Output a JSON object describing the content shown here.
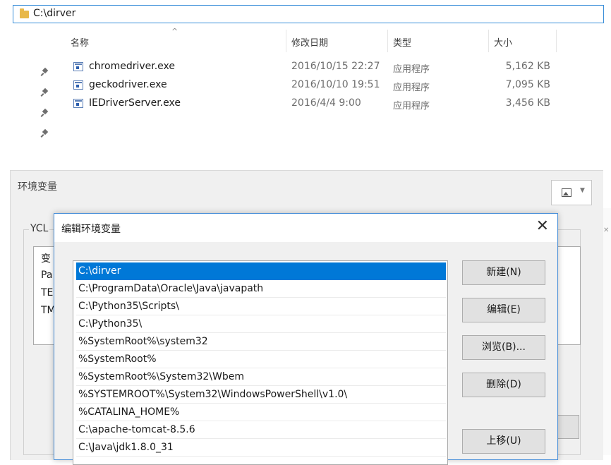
{
  "explorer": {
    "address": "C:\\dirver",
    "columns": {
      "name": "名称",
      "date": "修改日期",
      "type": "类型",
      "size": "大小"
    },
    "files": [
      {
        "name": "chromedriver.exe",
        "date": "2016/10/15 22:27",
        "type": "应用程序",
        "size": "5,162 KB"
      },
      {
        "name": "geckodriver.exe",
        "date": "2016/10/10 19:51",
        "type": "应用程序",
        "size": "7,095 KB"
      },
      {
        "name": "IEDriverServer.exe",
        "date": "2016/4/4 9:00",
        "type": "应用程序",
        "size": "3,456 KB"
      }
    ]
  },
  "env_window": {
    "title": "环境变量",
    "group_label": "YCL",
    "list_items": [
      "变",
      "Pa",
      "TE",
      "TM"
    ]
  },
  "dialog": {
    "title": "编辑环境变量",
    "paths": [
      "C:\\dirver",
      "C:\\ProgramData\\Oracle\\Java\\javapath",
      "C:\\Python35\\Scripts\\",
      "C:\\Python35\\",
      "%SystemRoot%\\system32",
      "%SystemRoot%",
      "%SystemRoot%\\System32\\Wbem",
      "%SYSTEMROOT%\\System32\\WindowsPowerShell\\v1.0\\",
      "%CATALINA_HOME%",
      "C:\\apache-tomcat-8.5.6",
      "C:\\Java\\jdk1.8.0_31"
    ],
    "buttons": {
      "new": "新建(N)",
      "edit": "编辑(E)",
      "browse": "浏览(B)...",
      "delete": "删除(D)",
      "move_up": "上移(U)"
    }
  },
  "colors": {
    "selection": "#0078d7",
    "dialog_border": "#4a90d9",
    "folder": "#e8b849"
  }
}
